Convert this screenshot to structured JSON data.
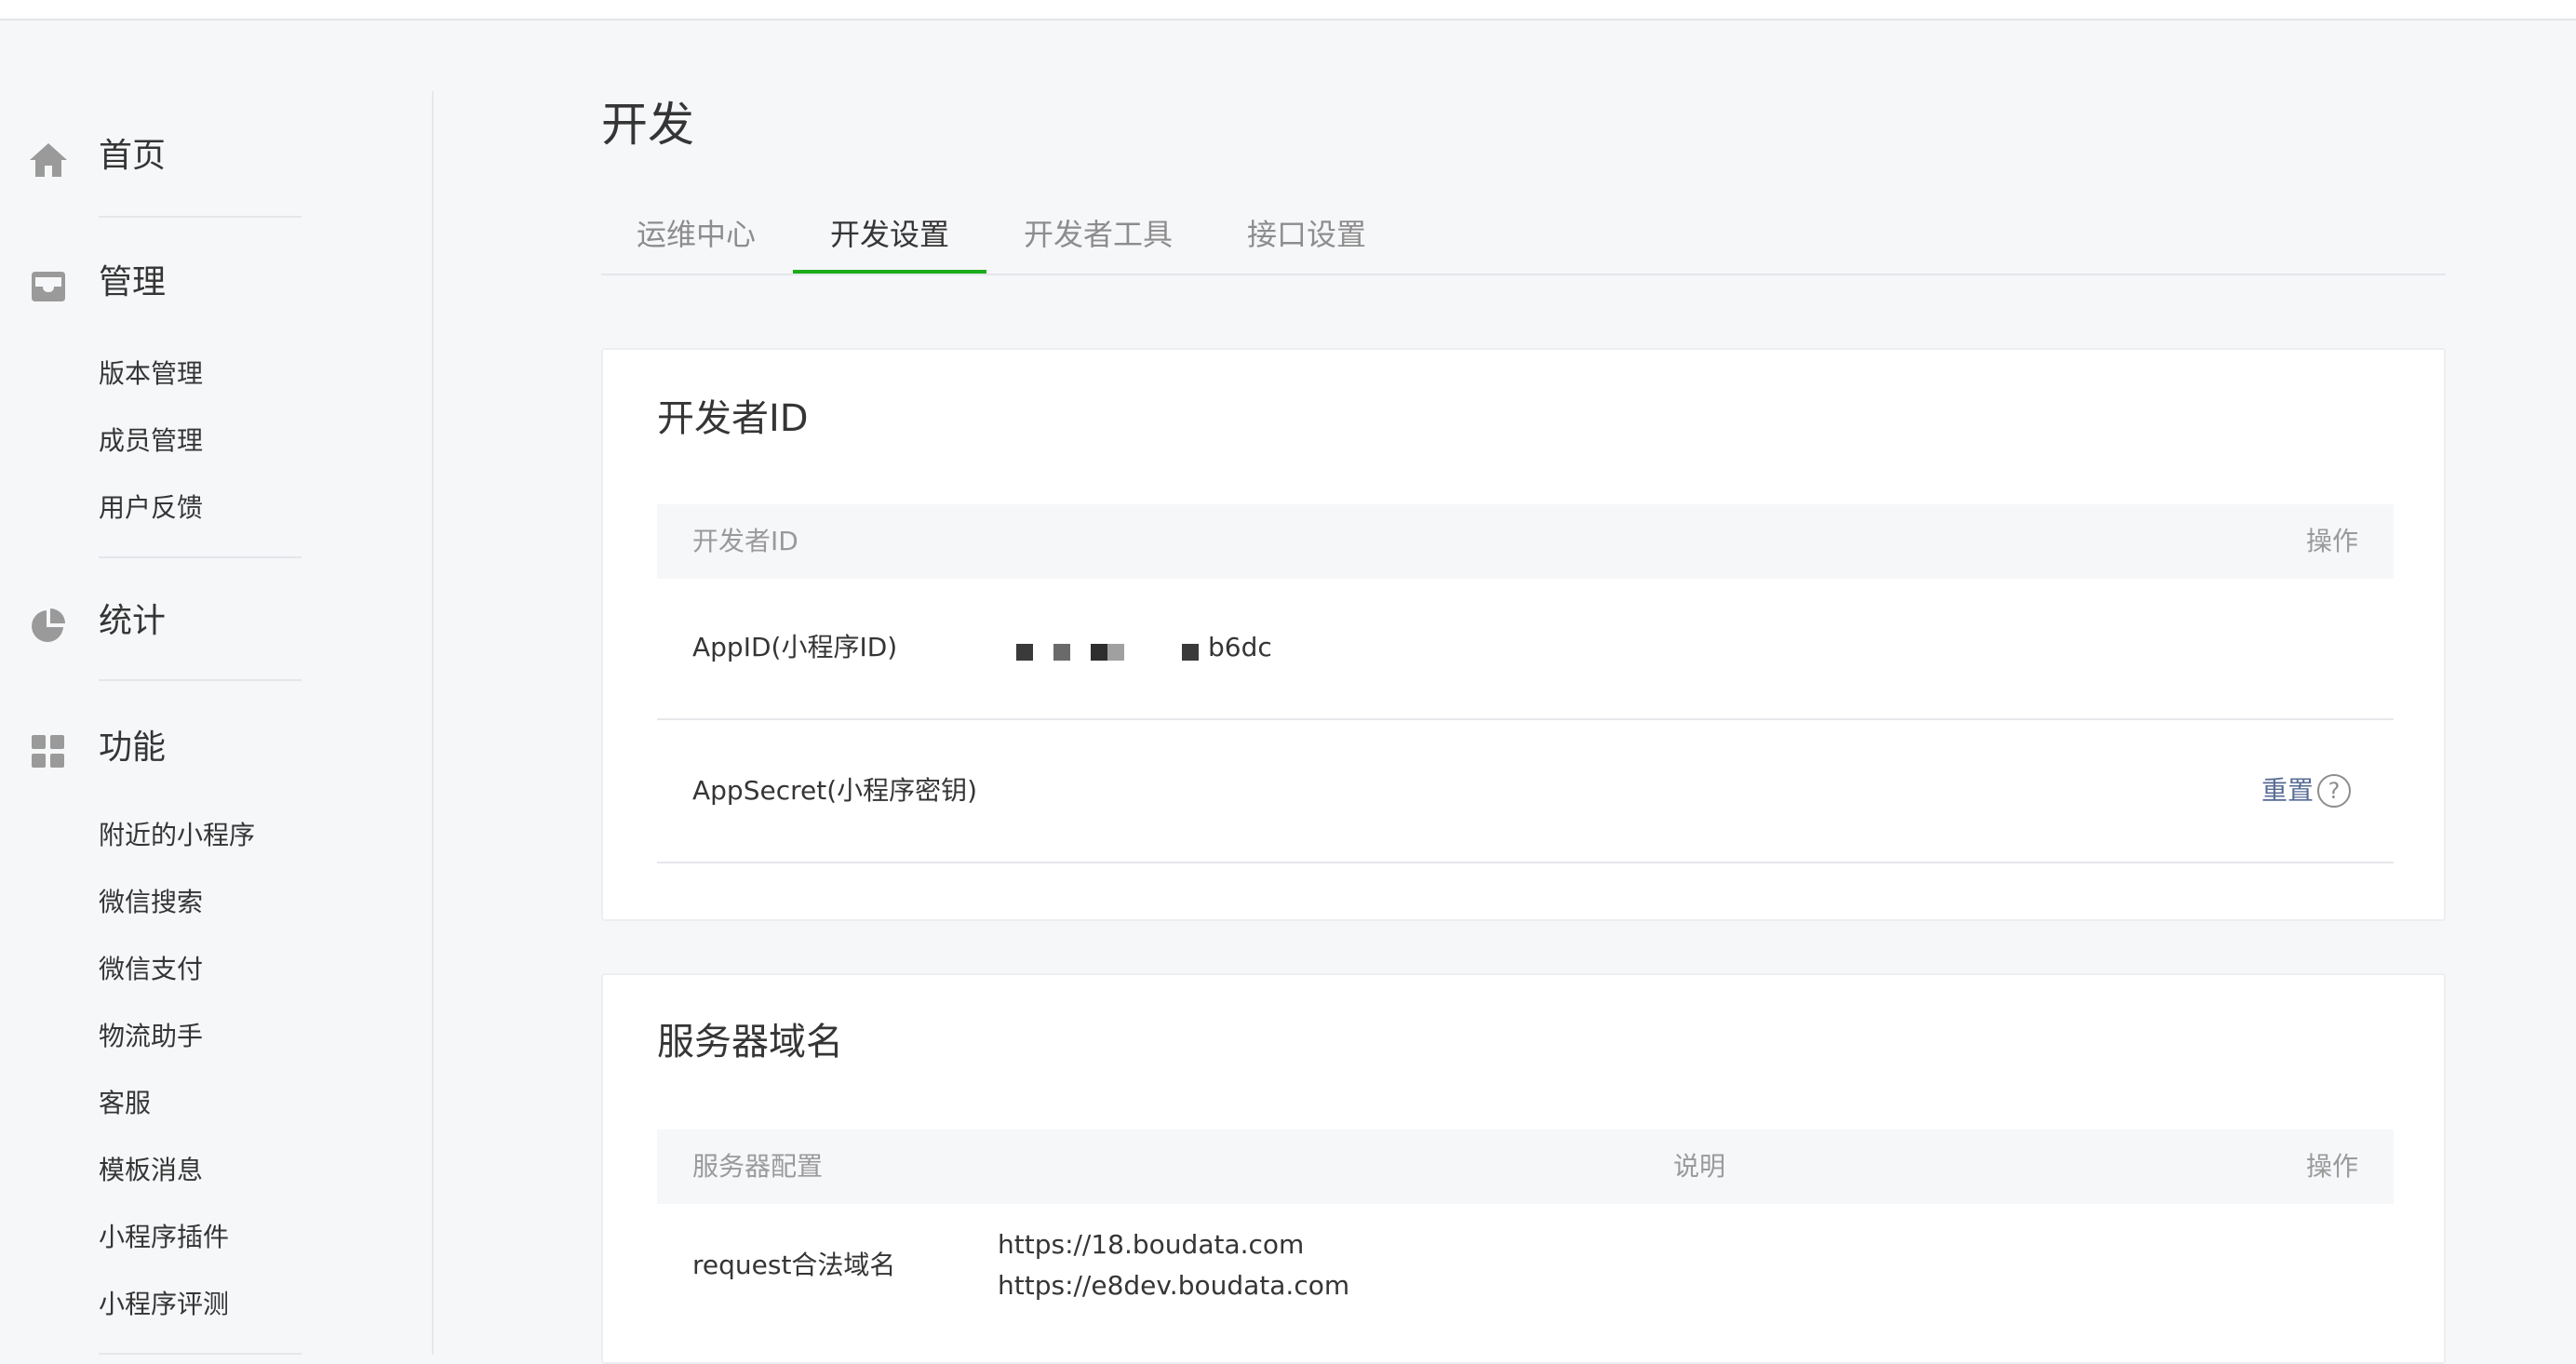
{
  "sidebar": {
    "home": {
      "label": "首页",
      "icon": "home-icon"
    },
    "manage": {
      "label": "管理",
      "icon": "inbox-icon",
      "items": [
        "版本管理",
        "成员管理",
        "用户反馈"
      ]
    },
    "stats": {
      "label": "统计",
      "icon": "pie-chart-icon"
    },
    "features": {
      "label": "功能",
      "icon": "grid-icon",
      "items": [
        "附近的小程序",
        "微信搜索",
        "微信支付",
        "物流助手",
        "客服",
        "模板消息",
        "小程序插件",
        "小程序评测"
      ]
    }
  },
  "main": {
    "title": "开发",
    "tabs": [
      {
        "label": "运维中心",
        "active": false
      },
      {
        "label": "开发设置",
        "active": true
      },
      {
        "label": "开发者工具",
        "active": false
      },
      {
        "label": "接口设置",
        "active": false
      }
    ],
    "developer_id": {
      "title": "开发者ID",
      "columns": {
        "name": "开发者ID",
        "action": "操作"
      },
      "appid": {
        "label": "AppID(小程序ID)",
        "value_suffix": "b6dc"
      },
      "appsecret": {
        "label": "AppSecret(小程序密钥)",
        "action": "重置",
        "help": "?"
      }
    },
    "server_domain": {
      "title": "服务器域名",
      "columns": {
        "config": "服务器配置",
        "desc": "说明",
        "action": "操作"
      },
      "request": {
        "label": "request合法域名",
        "domains": [
          "https://18.boudata.com",
          "https://e8dev.boudata.com"
        ]
      }
    }
  },
  "colors": {
    "accent": "#1aad19",
    "link": "#576b95",
    "icon": "#9a9a9a"
  }
}
